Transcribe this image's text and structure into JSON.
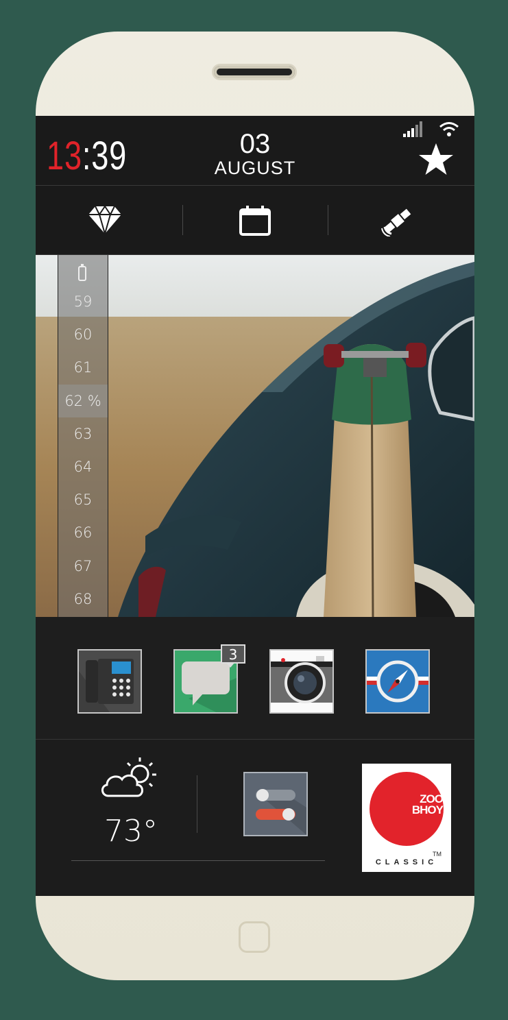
{
  "status": {
    "clock_hour": "13",
    "clock_sep": ":",
    "clock_min": "39",
    "date_day": "03",
    "date_month": "AUGUST"
  },
  "quick_toggles": [
    {
      "icon": "diamond-icon"
    },
    {
      "icon": "calendar-icon"
    },
    {
      "icon": "satellite-icon"
    }
  ],
  "battery": {
    "icon": "battery-icon",
    "levels": [
      "59",
      "60",
      "61",
      "62 %",
      "63",
      "64",
      "65",
      "66",
      "67",
      "68"
    ],
    "active_index": 3
  },
  "dock": {
    "apps": [
      {
        "icon": "phone-icon"
      },
      {
        "icon": "messages-icon",
        "badge": "3"
      },
      {
        "icon": "camera-icon"
      },
      {
        "icon": "compass-icon"
      }
    ]
  },
  "widgets": {
    "weather_icon": "partly-cloudy-icon",
    "temperature": "73°",
    "settings_icon": "toggle-settings-icon",
    "logo": {
      "line1": "ZOO",
      "line2": "BHOY",
      "tm": "TM",
      "tagline": "CLASSIC"
    }
  },
  "colors": {
    "accent": "#e0232a",
    "background": "#2f5a4e",
    "phone_body": "#ebe7da",
    "screen": "#1f1f1f"
  }
}
